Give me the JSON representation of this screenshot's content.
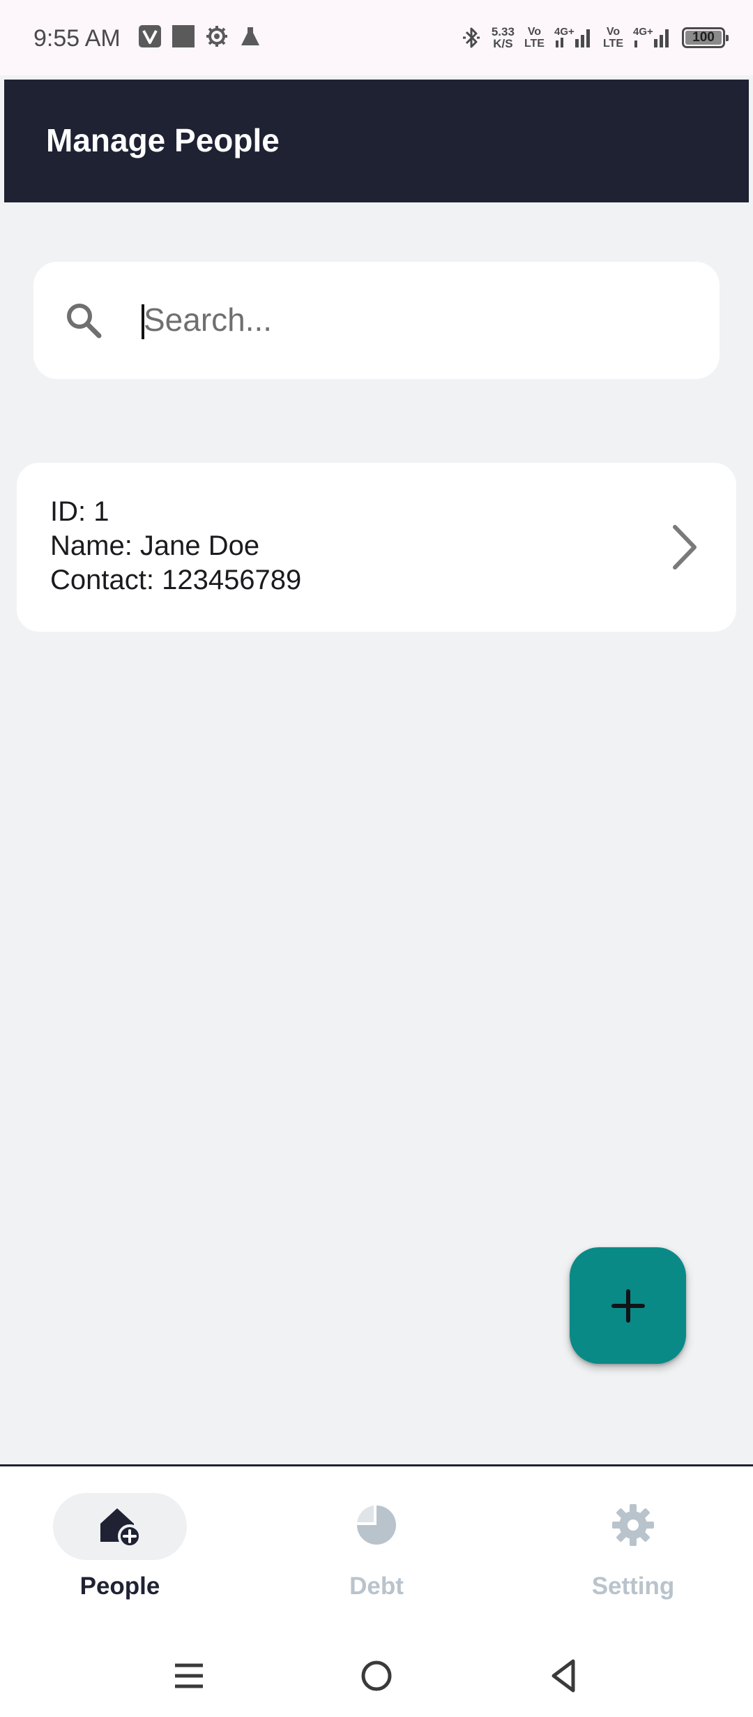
{
  "status_bar": {
    "time": "9:55 AM",
    "net_speed_value": "5.33",
    "net_speed_unit": "K/S",
    "volte_top": "Vo",
    "volte_bottom": "LTE",
    "network_label": "4G+",
    "battery_level": "100",
    "left_icons": [
      "v-app-icon",
      "square-app-icon",
      "gear-notification-icon",
      "flask-icon"
    ],
    "right_icons": [
      "bluetooth-icon",
      "signal-icon",
      "battery-icon"
    ]
  },
  "app_bar": {
    "title": "Manage People",
    "background": "#1e2233"
  },
  "search": {
    "placeholder": "Search...",
    "value": "",
    "icon": "search-icon"
  },
  "people": [
    {
      "id_line": "ID: 1",
      "name_line": "Name: Jane Doe",
      "contact_line": "Contact: 123456789",
      "action_icon": "chevron-right-icon"
    }
  ],
  "fab": {
    "icon": "plus-icon",
    "color": "#0a8a87"
  },
  "bottom_nav": {
    "items": [
      {
        "label": "People",
        "icon": "home-add-icon",
        "active": true
      },
      {
        "label": "Debt",
        "icon": "pie-chart-icon",
        "active": false
      },
      {
        "label": "Setting",
        "icon": "gear-icon",
        "active": false
      }
    ],
    "active_color": "#1e2233",
    "inactive_color": "#b9c3cc"
  },
  "system_nav": {
    "buttons": [
      "menu-icon",
      "home-circle-icon",
      "back-triangle-icon"
    ]
  }
}
